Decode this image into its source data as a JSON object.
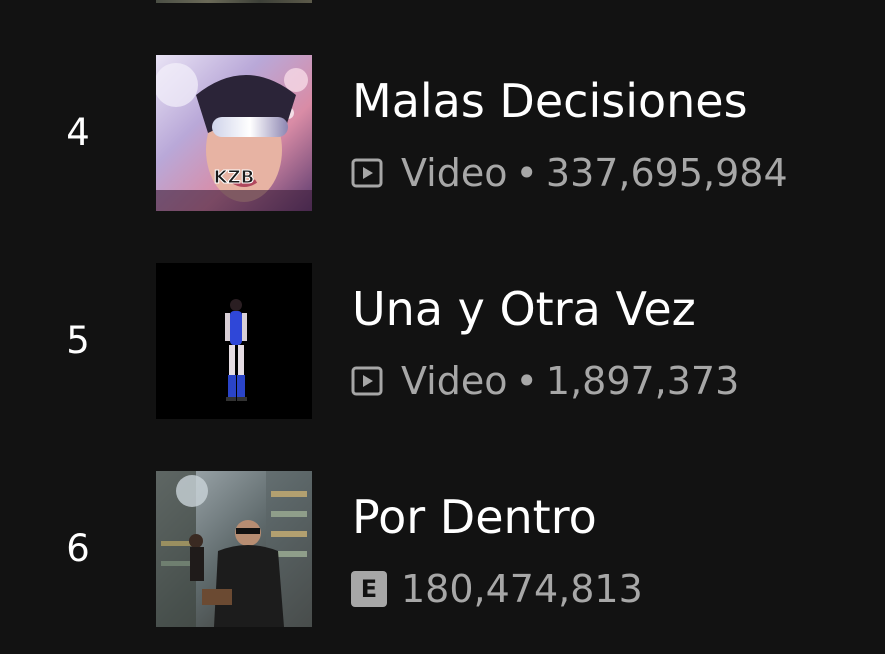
{
  "tracks": [
    {
      "rank": "4",
      "title": "Malas Decisiones",
      "type_label": "Video",
      "separator": "•",
      "plays": "337,695,984",
      "icon": "video-icon",
      "album_art_text": "KZB"
    },
    {
      "rank": "5",
      "title": "Una y Otra Vez",
      "type_label": "Video",
      "separator": "•",
      "plays": "1,897,373",
      "icon": "video-icon"
    },
    {
      "rank": "6",
      "title": "Por Dentro",
      "explicit_label": "E",
      "plays": "180,474,813",
      "icon": "explicit-icon"
    }
  ],
  "colors": {
    "background": "#121212",
    "primary_text": "#ffffff",
    "secondary_text": "#a7a7a7"
  }
}
